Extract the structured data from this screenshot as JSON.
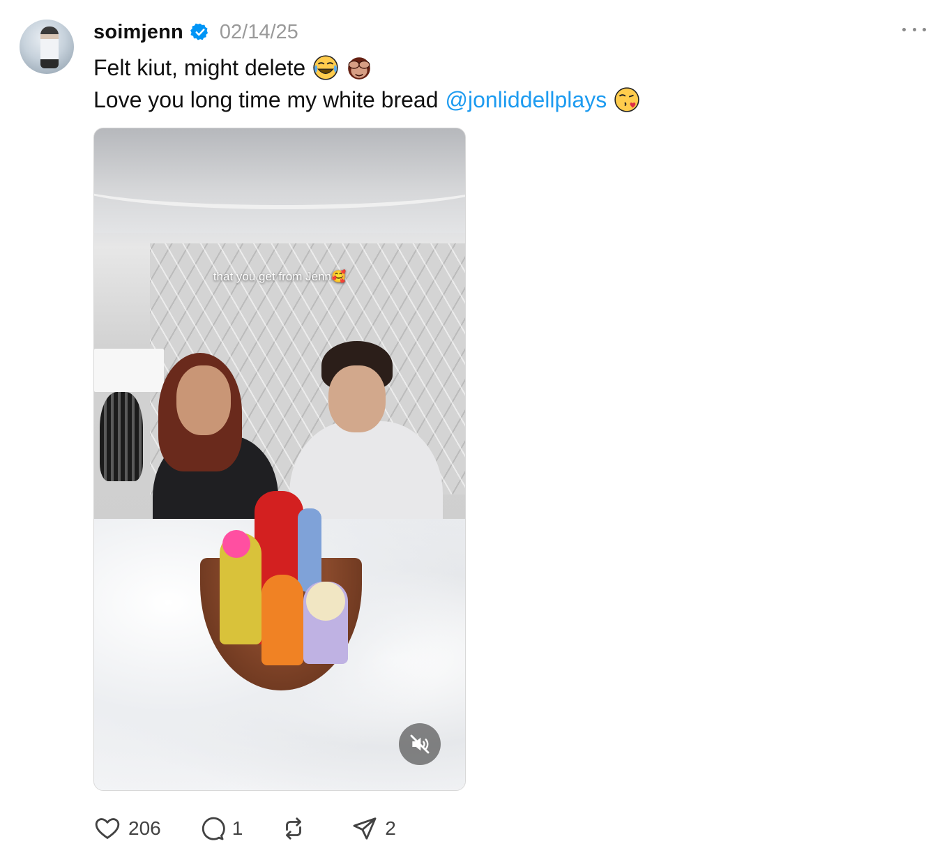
{
  "post": {
    "username": "soimjenn",
    "verified": true,
    "date": "02/14/25",
    "caption_line1": "Felt kiut, might delete",
    "caption_line1_emojis": [
      "face-with-tears-of-joy",
      "see-no-evil-monkey"
    ],
    "caption_line2": "Love you long time my white bread",
    "mention": "@jonliddellplays",
    "caption_line2_emoji": "face-blowing-a-kiss",
    "video_overlay_text": "that you get from Jenn🥰",
    "video_muted": true
  },
  "actions": {
    "likes": "206",
    "replies": "1",
    "reposts": "",
    "shares": "2"
  },
  "colors": {
    "mention": "#1d9bf0",
    "verified": "#0095f6",
    "date": "#9a9a9a",
    "icon": "#424242"
  },
  "icons": [
    "more-icon",
    "verified-badge-icon",
    "heart-icon",
    "comment-icon",
    "repost-icon",
    "share-icon",
    "mute-icon"
  ]
}
